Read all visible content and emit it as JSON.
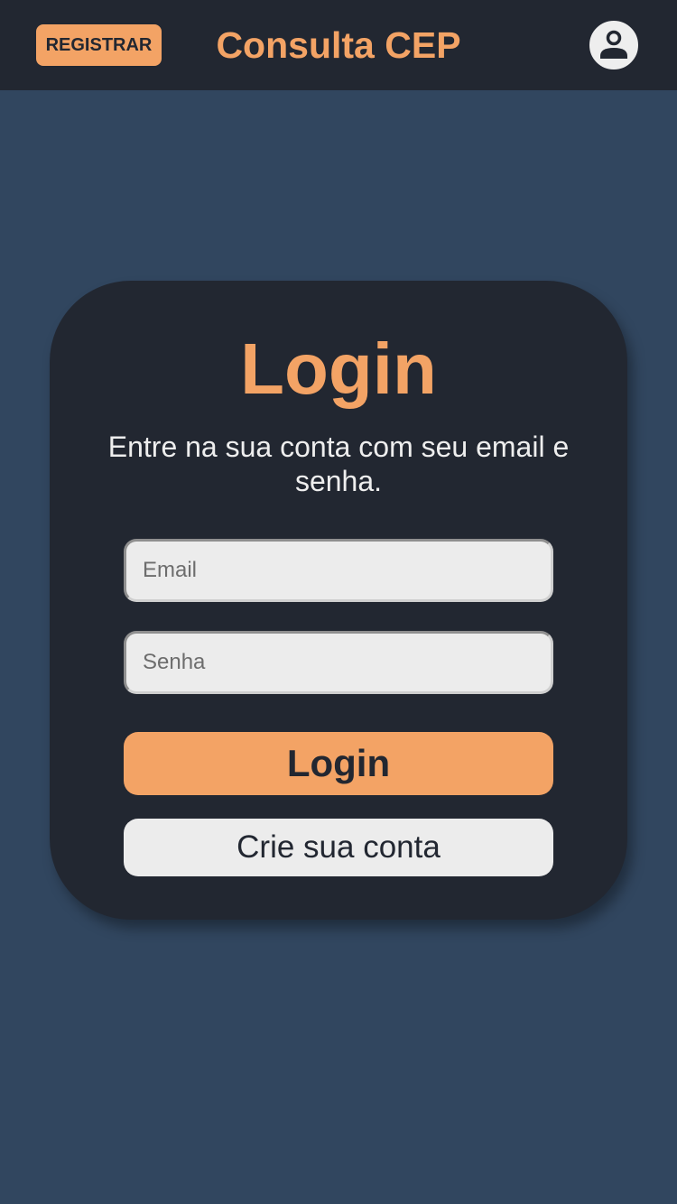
{
  "header": {
    "register_label": "REGISTRAR",
    "title": "Consulta CEP",
    "avatar_icon": "user-icon"
  },
  "login_card": {
    "title": "Login",
    "subtitle": "Entre na sua conta com seu email e senha.",
    "email_placeholder": "Email",
    "password_placeholder": "Senha",
    "login_label": "Login",
    "create_account_label": "Crie sua conta"
  },
  "colors": {
    "background": "#31465f",
    "surface": "#222731",
    "accent": "#f3a365",
    "light": "#ececec"
  }
}
